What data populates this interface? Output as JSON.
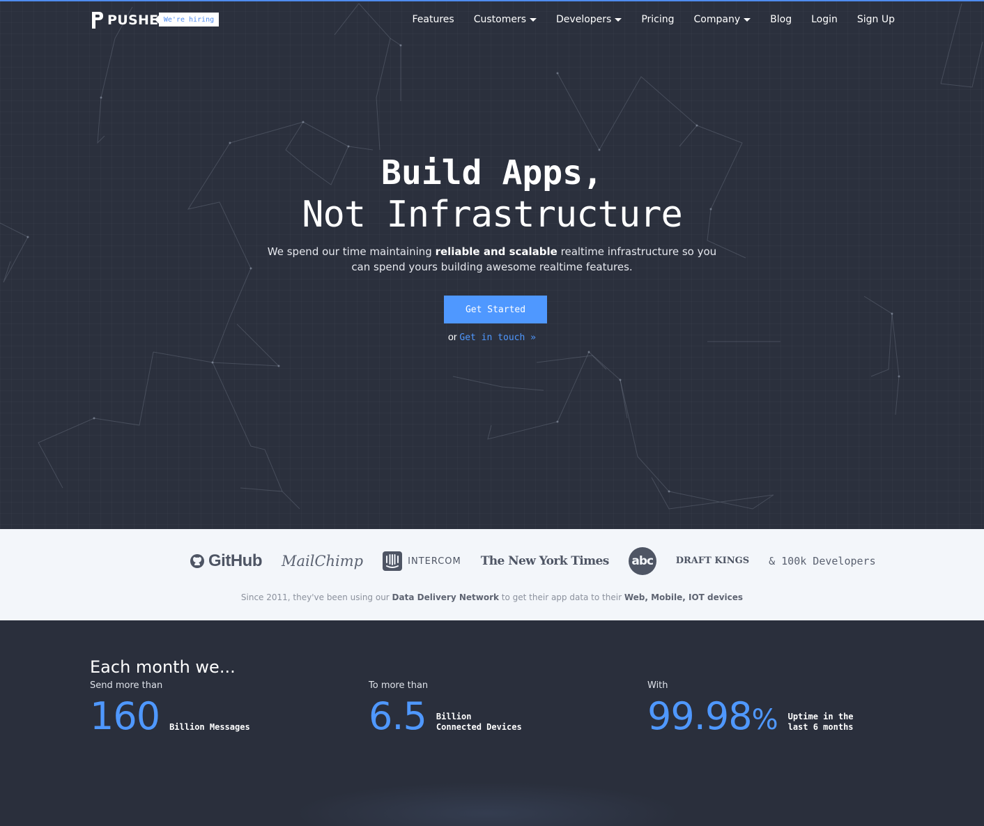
{
  "nav": {
    "logo_text": "PUSHER",
    "hiring_badge": "We're hiring",
    "items": [
      {
        "label": "Features",
        "has_caret": false
      },
      {
        "label": "Customers",
        "has_caret": true
      },
      {
        "label": "Developers",
        "has_caret": true
      },
      {
        "label": "Pricing",
        "has_caret": false
      },
      {
        "label": "Company",
        "has_caret": true
      },
      {
        "label": "Blog",
        "has_caret": false
      },
      {
        "label": "Login",
        "has_caret": false
      },
      {
        "label": "Sign Up",
        "has_caret": false
      }
    ]
  },
  "hero": {
    "title_line1": "Build Apps,",
    "title_line2": "Not Infrastructure",
    "subtitle_pre": "We spend our time maintaining ",
    "subtitle_bold": "reliable and scalable",
    "subtitle_post": " realtime infrastructure so you can spend yours building awesome realtime features.",
    "cta_label": "Get Started",
    "or_text": "or",
    "contact_link": "Get in touch »"
  },
  "customers": {
    "logos": [
      "GitHub",
      "MailChimp",
      "INTERCOM",
      "The New York Times",
      "abc",
      "DRAFT KINGS"
    ],
    "developers_text": "& 100k Developers",
    "caption_pre": "Since 2011, they've been using our ",
    "caption_bold1": "Data Delivery Network",
    "caption_mid": " to get their app data to their ",
    "caption_bold2": "Web, Mobile, IOT devices"
  },
  "stats": {
    "title": "Each month we...",
    "items": [
      {
        "label": "Send more than",
        "value": "160",
        "unit_line1": "Billion Messages",
        "unit_line2": ""
      },
      {
        "label": "To more than",
        "value": "6.5",
        "unit_line1": "Billion",
        "unit_line2": "Connected Devices"
      },
      {
        "label": "With",
        "value": "99.98",
        "suffix": "%",
        "unit_line1": "Uptime in the",
        "unit_line2": "last 6 months"
      }
    ]
  },
  "colors": {
    "accent": "#4f98ff",
    "hero_bg": "#2b303d",
    "band_bg": "#f3f6fa"
  },
  "icons": [
    "pusher-logo-icon",
    "github-octocat-icon",
    "intercom-icon",
    "caret-down-icon"
  ]
}
